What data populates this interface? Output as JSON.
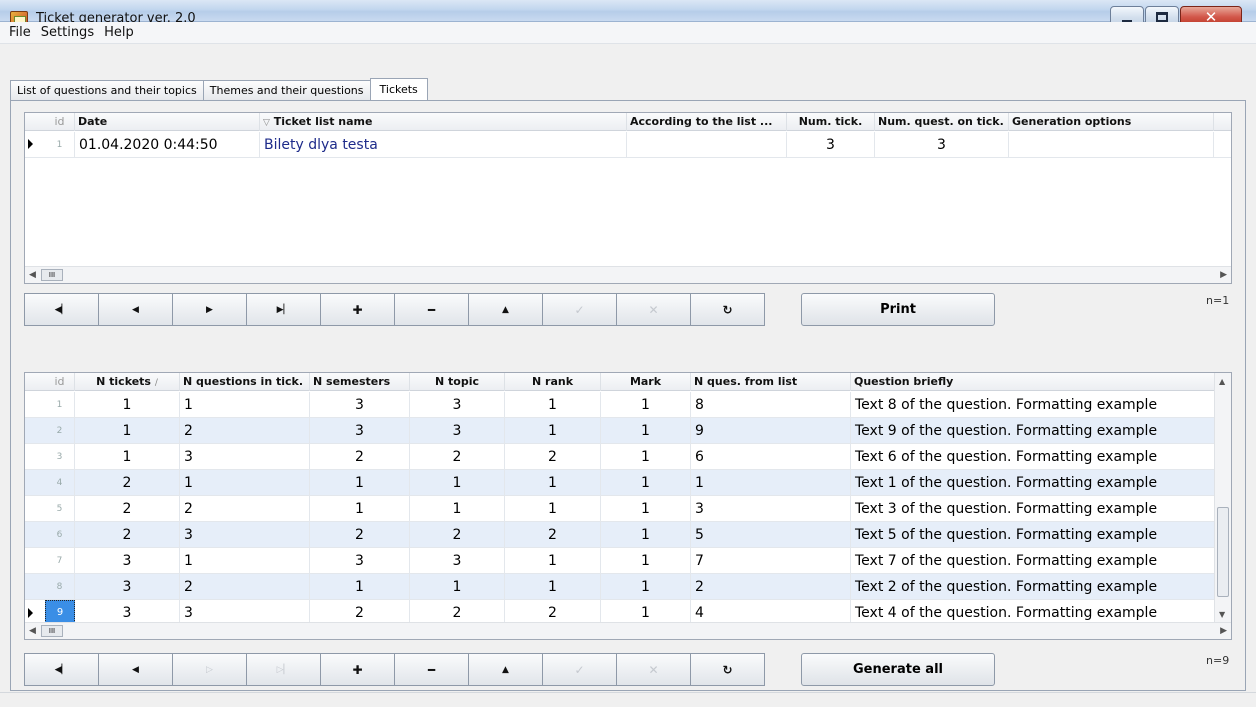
{
  "window": {
    "title": "Ticket generator ver. 2.0",
    "app_icon": "ticket-app-icon"
  },
  "menu": [
    "File",
    "Settings",
    "Help"
  ],
  "tabs": [
    {
      "label": "List of questions and their topics"
    },
    {
      "label": "Themes and their questions"
    },
    {
      "label": "Tickets"
    }
  ],
  "tickets_grid": {
    "headers": [
      "id",
      "Date",
      "Ticket list name",
      "According to the list ...",
      "Num. tick.",
      "Num. quest. on tick.",
      "Generation options"
    ],
    "sort_indicator": "▽",
    "rows": [
      {
        "id": "1",
        "date": "01.04.2020 0:44:50",
        "name": "Bilety dlya testa",
        "according": "",
        "num_tick": "3",
        "num_quest": "3",
        "options": ""
      }
    ],
    "scroll_glyph": "III"
  },
  "questions_grid": {
    "headers": [
      "id",
      "N tickets",
      "N questions in tick.",
      "N semesters",
      "N topic",
      "N rank",
      "Mark",
      "N ques. from list",
      "Question briefly"
    ],
    "sort_indicator": "∕",
    "rows": [
      {
        "id": "1",
        "n_tickets": "1",
        "n_q": "1",
        "n_sem": "3",
        "n_topic": "3",
        "n_rank": "1",
        "mark": "1",
        "n_from_list": "8",
        "brief": "Text 8 of the question. Formatting example"
      },
      {
        "id": "2",
        "n_tickets": "1",
        "n_q": "2",
        "n_sem": "3",
        "n_topic": "3",
        "n_rank": "1",
        "mark": "1",
        "n_from_list": "9",
        "brief": "Text 9 of the question. Formatting example"
      },
      {
        "id": "3",
        "n_tickets": "1",
        "n_q": "3",
        "n_sem": "2",
        "n_topic": "2",
        "n_rank": "2",
        "mark": "1",
        "n_from_list": "6",
        "brief": "Text 6 of the question. Formatting example"
      },
      {
        "id": "4",
        "n_tickets": "2",
        "n_q": "1",
        "n_sem": "1",
        "n_topic": "1",
        "n_rank": "1",
        "mark": "1",
        "n_from_list": "1",
        "brief": "Text 1 of the question. Formatting example"
      },
      {
        "id": "5",
        "n_tickets": "2",
        "n_q": "2",
        "n_sem": "1",
        "n_topic": "1",
        "n_rank": "1",
        "mark": "1",
        "n_from_list": "3",
        "brief": "Text 3 of the question. Formatting example"
      },
      {
        "id": "6",
        "n_tickets": "2",
        "n_q": "3",
        "n_sem": "2",
        "n_topic": "2",
        "n_rank": "2",
        "mark": "1",
        "n_from_list": "5",
        "brief": "Text 5 of the question. Formatting example"
      },
      {
        "id": "7",
        "n_tickets": "3",
        "n_q": "1",
        "n_sem": "3",
        "n_topic": "3",
        "n_rank": "1",
        "mark": "1",
        "n_from_list": "7",
        "brief": "Text 7 of the question. Formatting example"
      },
      {
        "id": "8",
        "n_tickets": "3",
        "n_q": "2",
        "n_sem": "1",
        "n_topic": "1",
        "n_rank": "1",
        "mark": "1",
        "n_from_list": "2",
        "brief": "Text 2 of the question. Formatting example"
      },
      {
        "id": "9",
        "n_tickets": "3",
        "n_q": "3",
        "n_sem": "2",
        "n_topic": "2",
        "n_rank": "2",
        "mark": "1",
        "n_from_list": "4",
        "brief": "Text 4 of the question. Formatting example"
      }
    ],
    "scroll_glyph": "III"
  },
  "nav_top": {
    "buttons": [
      {
        "icon": "first-record-icon",
        "glyph": "◀▏",
        "enabled": true
      },
      {
        "icon": "prior-record-icon",
        "glyph": "◀",
        "enabled": true
      },
      {
        "icon": "next-record-icon",
        "glyph": "▶",
        "enabled": true
      },
      {
        "icon": "last-record-icon",
        "glyph": "▶▏",
        "enabled": true
      },
      {
        "icon": "insert-record-icon",
        "glyph": "✚",
        "enabled": true
      },
      {
        "icon": "delete-record-icon",
        "glyph": "━",
        "enabled": true
      },
      {
        "icon": "edit-record-icon",
        "glyph": "▲",
        "enabled": true
      },
      {
        "icon": "post-record-icon",
        "glyph": "✓",
        "enabled": false
      },
      {
        "icon": "cancel-edit-icon",
        "glyph": "✕",
        "enabled": false
      },
      {
        "icon": "refresh-icon",
        "glyph": "↻",
        "enabled": true
      }
    ],
    "action_label": "Print",
    "count": "n=1"
  },
  "nav_bottom": {
    "buttons": [
      {
        "icon": "first-record-icon",
        "glyph": "◀▏",
        "enabled": true
      },
      {
        "icon": "prior-record-icon",
        "glyph": "◀",
        "enabled": true
      },
      {
        "icon": "next-record-icon",
        "glyph": "▷",
        "enabled": false
      },
      {
        "icon": "last-record-icon",
        "glyph": "▷▏",
        "enabled": false
      },
      {
        "icon": "insert-record-icon",
        "glyph": "✚",
        "enabled": true
      },
      {
        "icon": "delete-record-icon",
        "glyph": "━",
        "enabled": true
      },
      {
        "icon": "edit-record-icon",
        "glyph": "▲",
        "enabled": true
      },
      {
        "icon": "post-record-icon",
        "glyph": "✓",
        "enabled": false
      },
      {
        "icon": "cancel-edit-icon",
        "glyph": "✕",
        "enabled": false
      },
      {
        "icon": "refresh-icon",
        "glyph": "↻",
        "enabled": true
      }
    ],
    "action_label": "Generate all",
    "count": "n=9"
  }
}
